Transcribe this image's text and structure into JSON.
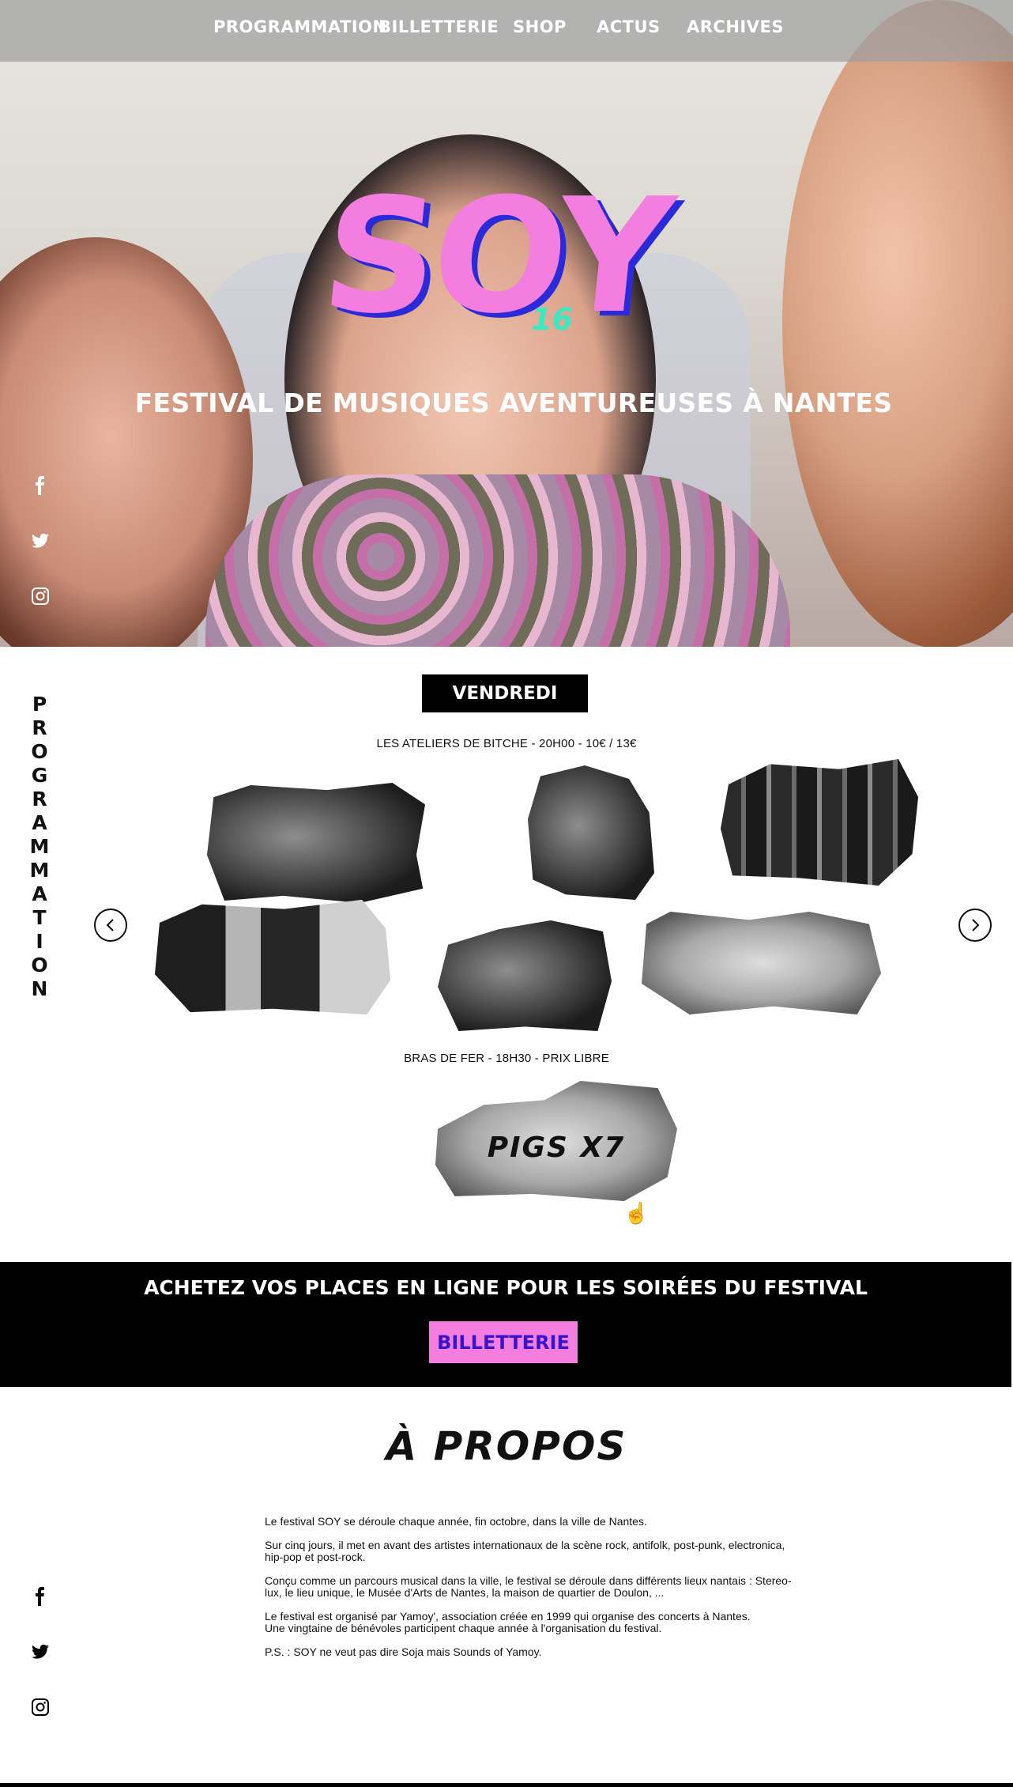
{
  "nav": {
    "items": [
      "PROGRAMMATION",
      "BILLETTERIE",
      "SHOP",
      "ACTUS",
      "ARCHIVES"
    ]
  },
  "hero": {
    "logo_text": "SOY",
    "logo_number": "16",
    "tagline": "FESTIVAL DE MUSIQUES AVENTUREUSES À NANTES"
  },
  "social": {
    "icons": [
      "facebook-icon",
      "twitter-icon",
      "instagram-icon"
    ]
  },
  "programmation": {
    "vertical_title": "PROGRAMMATION",
    "day": "VENDREDI",
    "venue_1": "LES ATELIERS DE BITCHE - 20H00 - 10€ / 13€",
    "venue_2": "BRAS DE FER - 18H30 - PRIX LIBRE",
    "pigs_label": "PIGS X7"
  },
  "banner": {
    "text": "ACHETEZ VOS PLACES EN LIGNE POUR LES SOIRÉES DU FESTIVAL",
    "button": "BILLETTERIE"
  },
  "about": {
    "title": "À PROPOS",
    "p1": "Le festival SOY se déroule chaque année, fin octobre, dans la ville de Nantes.",
    "p2a": "Sur cinq jours, il met en avant des artistes internationaux de la scène rock, antifolk, post-punk, electronica,",
    "p2b": "hip-pop et post-rock.",
    "p3a": "Conçu comme un parcours musical dans la ville, le festival se déroule dans différents lieux nantais : Stereo-",
    "p3b": "lux, le lieu unique, le Musée d'Arts de Nantes, la maison de quartier de Doulon, ...",
    "p4a": "Le festival est organisé par Yamoy', association créée en 1999 qui organise des concerts à Nantes.",
    "p4b": "Une vingtaine de bénévoles participent chaque année à l'organisation du festival.",
    "p5": "P.S. : SOY ne veut pas dire Soja mais Sounds of Yamoy."
  },
  "colors": {
    "accent_pink": "#f47ee0",
    "accent_blue": "#2a2ad8",
    "accent_teal": "#3be8c4",
    "ticket_text": "#3a14c8"
  }
}
